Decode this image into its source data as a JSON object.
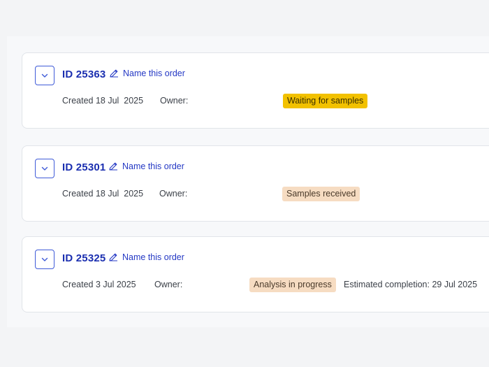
{
  "orders": [
    {
      "id": "ID 25363",
      "name_link": "Name this order",
      "created": "Created 18 Jul  2025",
      "owner_label": "Owner:",
      "status": "Waiting for samples",
      "status_color": "#f2c100",
      "estimated": ""
    },
    {
      "id": "ID 25301",
      "name_link": "Name this order",
      "created": "Created 18 Jul  2025",
      "owner_label": "Owner:",
      "status": "Samples received",
      "status_color": "#f6dcc2",
      "estimated": ""
    },
    {
      "id": "ID 25325",
      "name_link": "Name this order",
      "created": "Created 3 Jul 2025",
      "owner_label": "Owner:",
      "status": "Analysis in progress",
      "status_color": "#f6dcc2",
      "estimated": "Estimated completion: 29 Jul 2025"
    }
  ],
  "icons": {
    "toggle": "chevron-down-icon",
    "name_link": "pencil-icon"
  }
}
